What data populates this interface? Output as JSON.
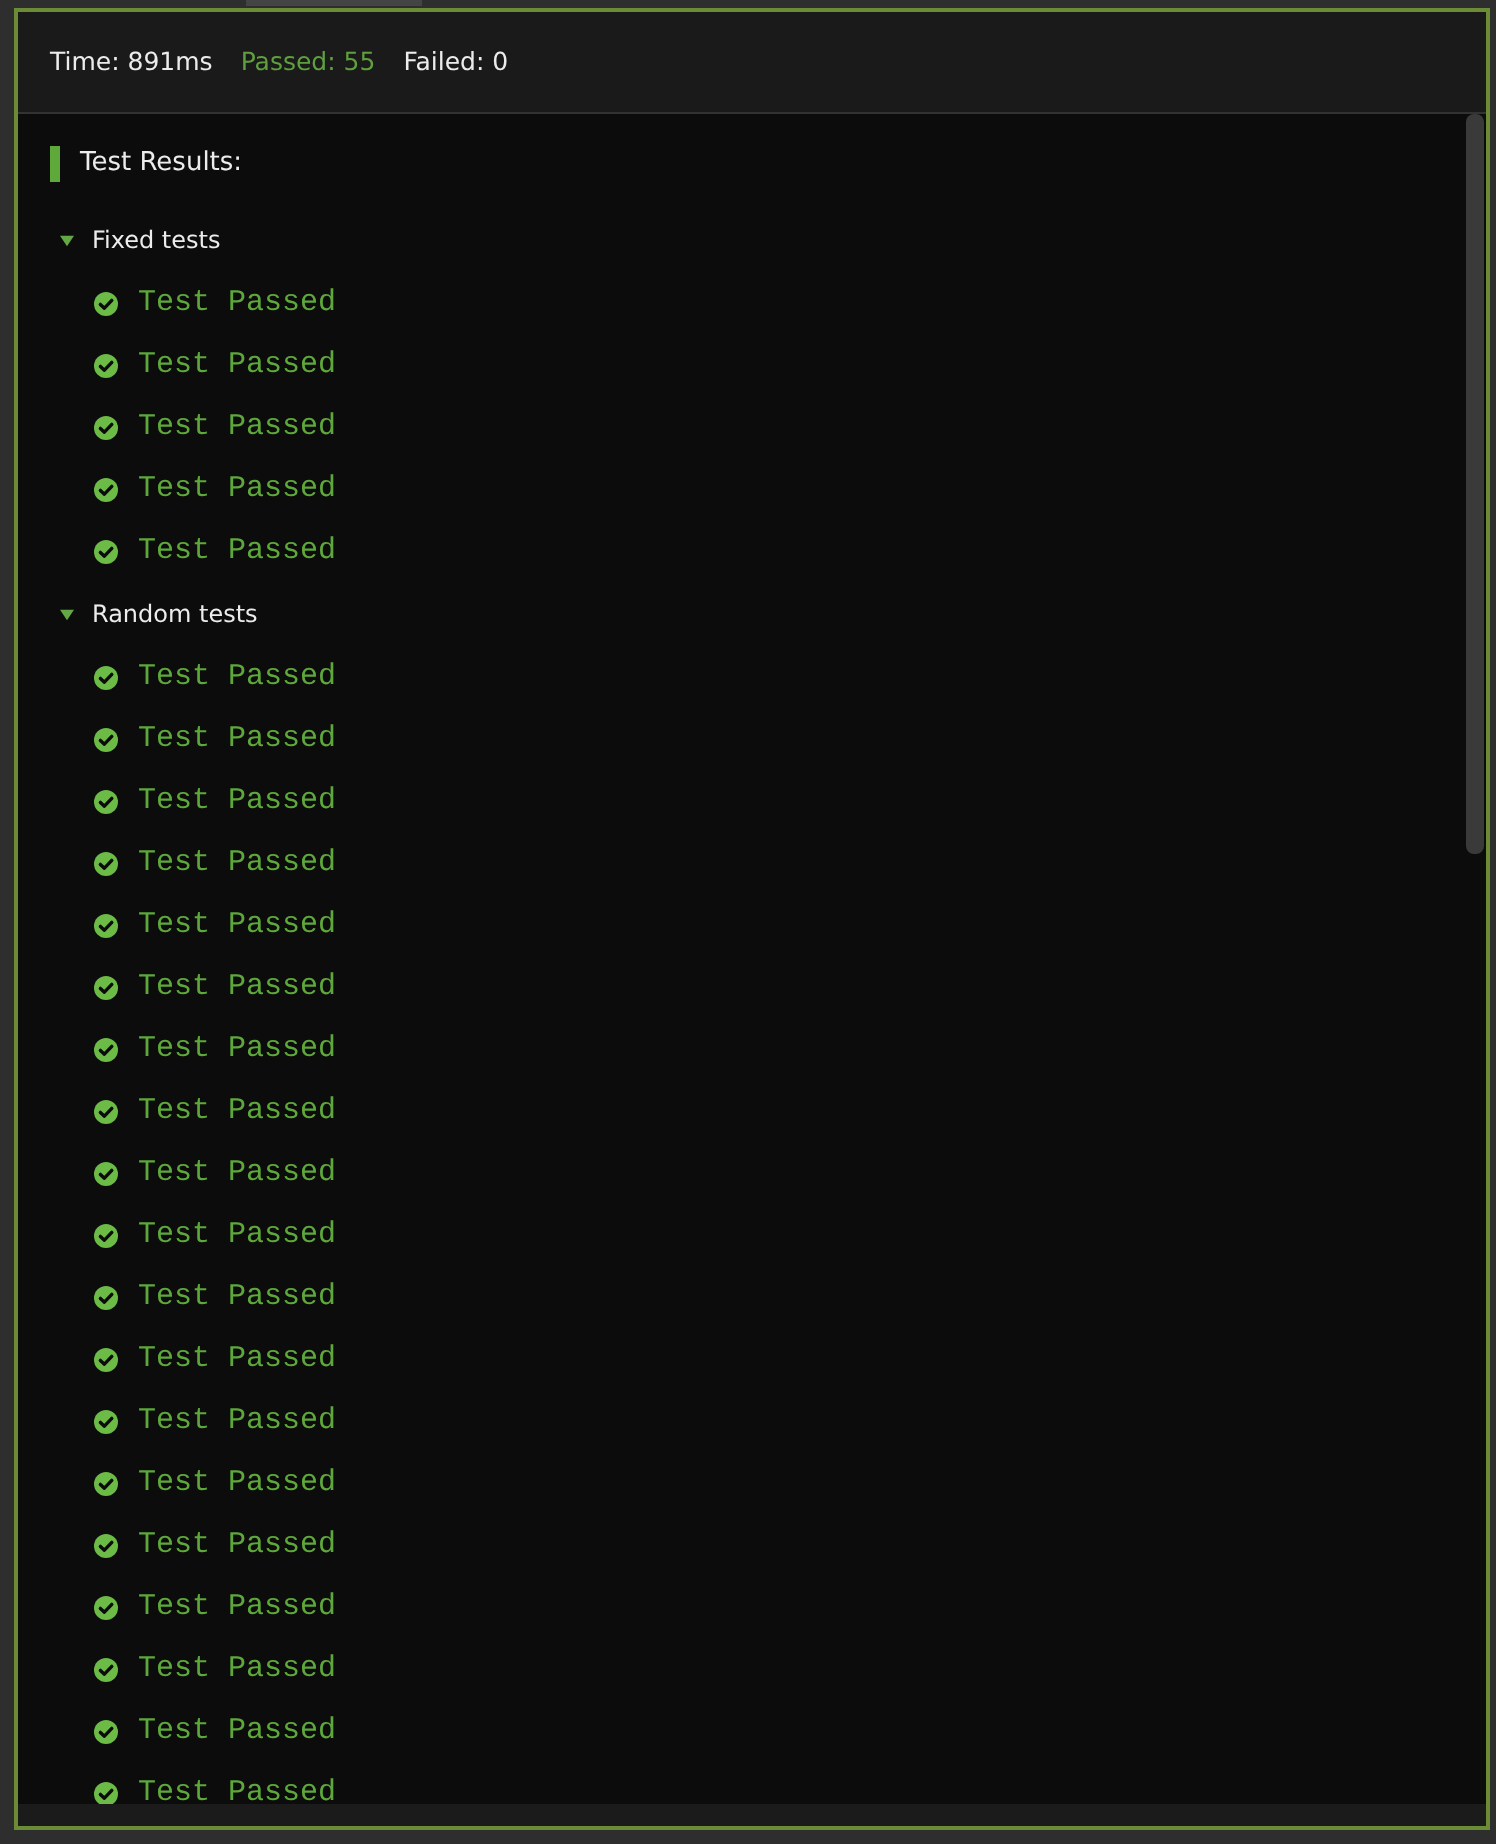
{
  "stats": [
    {
      "kind": "time",
      "text": "Time: 891ms"
    },
    {
      "kind": "passed",
      "text": "Passed: 55"
    },
    {
      "kind": "failed",
      "text": "Failed: 0"
    }
  ],
  "results": {
    "title": "Test Results:",
    "groups": [
      {
        "label": "Fixed tests",
        "expanded": true,
        "tests": [
          {
            "text": "Test Passed",
            "passed": true
          },
          {
            "text": "Test Passed",
            "passed": true
          },
          {
            "text": "Test Passed",
            "passed": true
          },
          {
            "text": "Test Passed",
            "passed": true
          },
          {
            "text": "Test Passed",
            "passed": true
          }
        ]
      },
      {
        "label": "Random tests",
        "expanded": true,
        "tests": [
          {
            "text": "Test Passed",
            "passed": true
          },
          {
            "text": "Test Passed",
            "passed": true
          },
          {
            "text": "Test Passed",
            "passed": true
          },
          {
            "text": "Test Passed",
            "passed": true
          },
          {
            "text": "Test Passed",
            "passed": true
          },
          {
            "text": "Test Passed",
            "passed": true
          },
          {
            "text": "Test Passed",
            "passed": true
          },
          {
            "text": "Test Passed",
            "passed": true
          },
          {
            "text": "Test Passed",
            "passed": true
          },
          {
            "text": "Test Passed",
            "passed": true
          },
          {
            "text": "Test Passed",
            "passed": true
          },
          {
            "text": "Test Passed",
            "passed": true
          },
          {
            "text": "Test Passed",
            "passed": true
          },
          {
            "text": "Test Passed",
            "passed": true
          },
          {
            "text": "Test Passed",
            "passed": true
          },
          {
            "text": "Test Passed",
            "passed": true
          },
          {
            "text": "Test Passed",
            "passed": true
          },
          {
            "text": "Test Passed",
            "passed": true
          },
          {
            "text": "Test Passed",
            "passed": true
          }
        ]
      }
    ]
  }
}
